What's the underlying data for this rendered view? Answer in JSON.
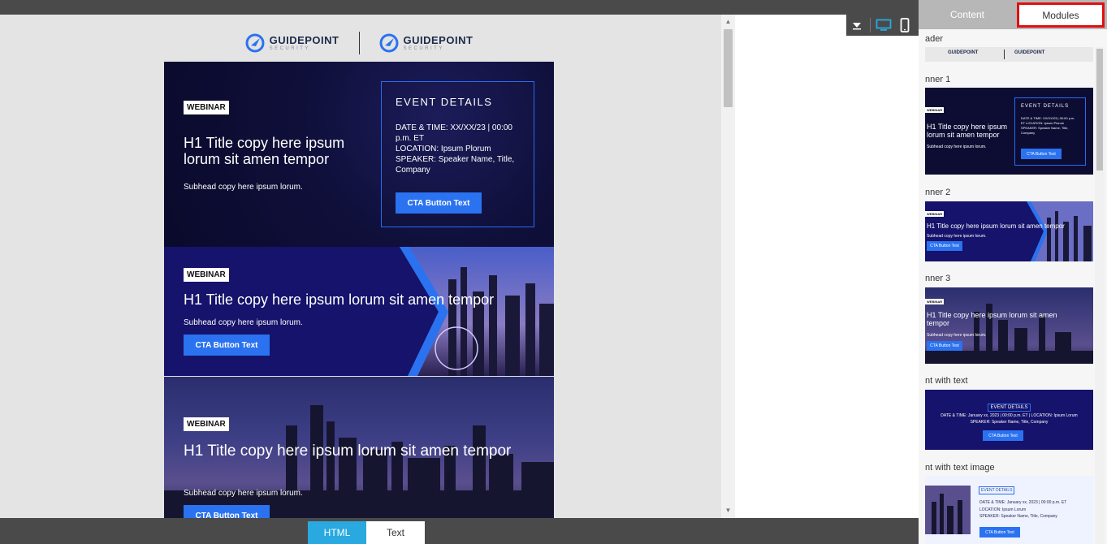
{
  "editor": {
    "view_tabs": {
      "html": "HTML",
      "text": "Text"
    }
  },
  "email": {
    "logos": [
      {
        "name": "GUIDEPOINT",
        "sub": "SECURITY"
      },
      {
        "name": "GUIDEPOINT",
        "sub": "SECURITY"
      }
    ],
    "banner1": {
      "badge": "WEBINAR",
      "title": "H1 Title copy here ipsum lorum sit amen tempor",
      "subhead": "Subhead copy here ipsum lorum.",
      "event_title": "EVENT DETAILS",
      "event_lines": [
        "DATE & TIME: XX/XX/23 | 00:00 p.m. ET",
        "LOCATION: Ipsum Plorum",
        "SPEAKER: Speaker Name, Title, Company"
      ],
      "cta": "CTA Button Text"
    },
    "banner2": {
      "badge": "WEBINAR",
      "title": "H1 Title copy here ipsum lorum sit amen tempor",
      "subhead": "Subhead copy here ipsum lorum.",
      "cta": "CTA Button Text"
    },
    "banner3": {
      "badge": "WEBINAR",
      "title": "H1 Title copy here ipsum lorum sit amen tempor",
      "subhead": "Subhead copy here ipsum lorum.",
      "cta": "CTA Button Text"
    }
  },
  "panel": {
    "tabs": {
      "content": "Content",
      "modules": "Modules"
    },
    "modules": [
      {
        "label": "ader"
      },
      {
        "label": "nner 1",
        "mini_title": "H1 Title copy here ipsum lorum sit amen tempor",
        "mini_sub": "Subhead copy here ipsum lorum.",
        "mini_event": "EVENT DETAILS",
        "mini_event_text": "DATE & TIME: XX/XX/23 | 00:00 p.m. ET LOCATION: Ipsum Plorum SPEAKER: Speaker Name, Title, Company",
        "mini_cta": "CTA Button Text",
        "mini_badge": "WEBINAR"
      },
      {
        "label": "nner 2",
        "mini_title": "H1 Title copy here ipsum lorum sit amen tempor",
        "mini_sub": "Subhead copy here ipsum lorum.",
        "mini_cta": "CTA Button Text",
        "mini_badge": "WEBINAR"
      },
      {
        "label": "nner 3",
        "mini_title": "H1 Title copy here ipsum lorum sit amen tempor",
        "mini_sub": "Subhead copy here ipsum lorum.",
        "mini_cta": "CTA Button Text",
        "mini_badge": "WEBINAR"
      },
      {
        "label": "nt with text",
        "mini_event": "EVENT DETAILS",
        "mini_line1": "DATE & TIME: January xx, 2023 | 00:00 p.m. ET | LOCATION: Ipsum Lorum",
        "mini_line2": "SPEAKER: Speaker Name, Title, Company",
        "mini_cta": "CTA Button Text"
      },
      {
        "label": "nt with text image",
        "mini_event": "EVENT DETAILS",
        "mini_line1": "DATE & TIME: January xx, 2023 | 00:00 p.m. ET",
        "mini_line2": "LOCATION: Ipsum Lorum",
        "mini_line3": "SPEAKER: Speaker Name, Title, Company",
        "mini_cta": "CTA Button Text"
      }
    ]
  },
  "colors": {
    "accent_blue": "#2a72f0",
    "highlight_red": "#e01010",
    "html_tab": "#29a9e0"
  }
}
